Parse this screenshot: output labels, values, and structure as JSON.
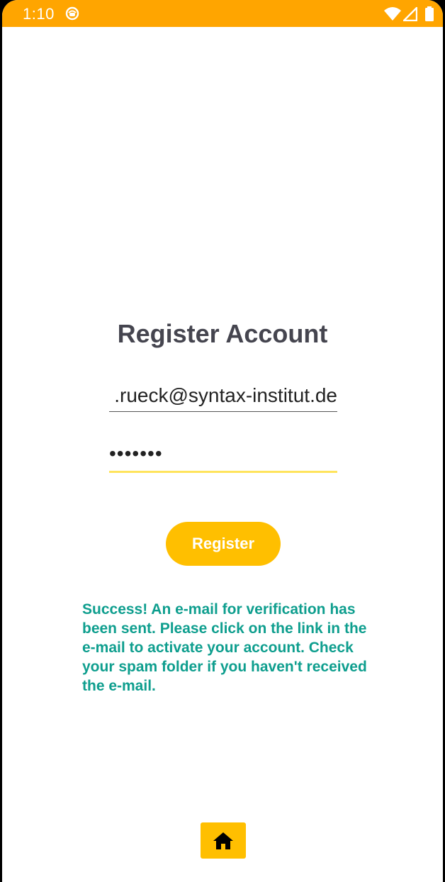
{
  "status_bar": {
    "time": "1:10",
    "app_icon": "notification-app-icon",
    "icons": [
      "wifi-icon",
      "cellular-signal-icon",
      "battery-icon"
    ],
    "color": "#FFA500"
  },
  "form": {
    "title": "Register Account",
    "email_value": ".rueck@syntax-institut.de",
    "password_value": "•••••••",
    "register_label": "Register",
    "accent_color": "#FFBF00"
  },
  "message": {
    "text": "Success! An e-mail for verification has been sent. Please click on the link in the e-mail to activate your account. Check your spam folder if you haven't received the e-mail.",
    "color": "#0E9E8E"
  },
  "bottom_nav": {
    "home_icon": "home-icon"
  }
}
